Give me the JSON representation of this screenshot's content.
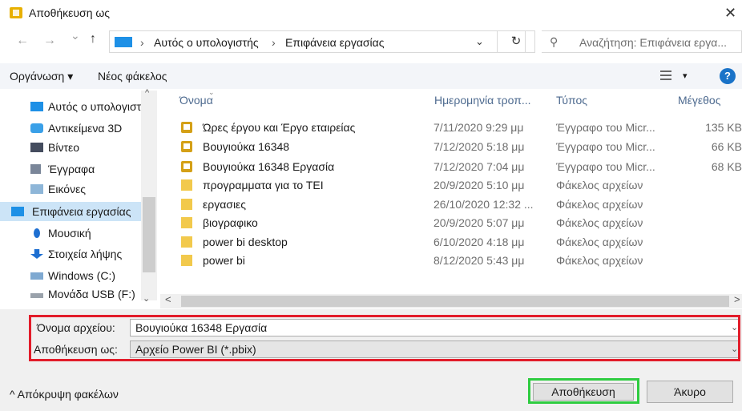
{
  "window": {
    "title": "Αποθήκευση ως",
    "close_glyph": "✕"
  },
  "nav": {
    "back_glyph": "←",
    "forward_glyph": "→",
    "recent_glyph": "⌄",
    "up_glyph": "↑",
    "breadcrumb": [
      "Αυτός ο υπολογιστής",
      "Επιφάνεια εργασίας"
    ],
    "separator": "›",
    "dropdown_glyph": "⌄",
    "refresh_glyph": "↻",
    "search_placeholder": "Αναζήτηση: Επιφάνεια εργα..."
  },
  "toolbar": {
    "organize_label": "Οργάνωση ▾",
    "new_folder_label": "Νέος φάκελος",
    "view_dropdown_glyph": "▾",
    "help_glyph": "?"
  },
  "sidebar": {
    "items": [
      {
        "label": "Αυτός ο υπολογιστής",
        "icon": "computer-icon",
        "color": "#1e90e6"
      },
      {
        "label": "Αντικείμενα 3D",
        "icon": "cube-3d-icon",
        "color": "#3aa0e8"
      },
      {
        "label": "Βίντεο",
        "icon": "film-icon",
        "color": "#444c5e"
      },
      {
        "label": "Έγγραφα",
        "icon": "document-icon",
        "color": "#7a8699"
      },
      {
        "label": "Εικόνες",
        "icon": "pictures-icon",
        "color": "#8eb6d8"
      },
      {
        "label": "Επιφάνεια εργασίας",
        "icon": "desktop-icon",
        "color": "#1e90e6",
        "selected": true
      },
      {
        "label": "Μουσική",
        "icon": "music-icon",
        "color": "#1e6fd1"
      },
      {
        "label": "Στοιχεία λήψης",
        "icon": "download-icon",
        "color": "#1e6fd1"
      },
      {
        "label": "Windows (C:)",
        "icon": "drive-icon",
        "color": "#7fa9d1"
      },
      {
        "label": "Μονάδα USB (F:)",
        "icon": "usb-drive-icon",
        "color": "#9aa2ab"
      }
    ]
  },
  "columns": {
    "name": "Όνομα",
    "date": "Ημερομηνία τροπ...",
    "type": "Τύπος",
    "size": "Μέγεθος"
  },
  "files": [
    {
      "name": "Ώρες έργου και Έργο εταιρείας",
      "date": "7/11/2020 9:29 μμ",
      "type": "Έγγραφο του Micr...",
      "size": "135 KB",
      "kind": "doc"
    },
    {
      "name": "Βουγιούκα 16348",
      "date": "7/12/2020 5:18 μμ",
      "type": "Έγγραφο του Micr...",
      "size": "66 KB",
      "kind": "doc"
    },
    {
      "name": "Βουγιούκα 16348 Εργασία",
      "date": "7/12/2020 7:04 μμ",
      "type": "Έγγραφο του Micr...",
      "size": "68 KB",
      "kind": "doc"
    },
    {
      "name": "προγραμματα για το ΤΕΙ",
      "date": "20/9/2020 5:10 μμ",
      "type": "Φάκελος αρχείων",
      "size": "",
      "kind": "folder"
    },
    {
      "name": "εργασιες",
      "date": "26/10/2020 12:32 ...",
      "type": "Φάκελος αρχείων",
      "size": "",
      "kind": "folder"
    },
    {
      "name": "βιογραφικο",
      "date": "20/9/2020 5:07 μμ",
      "type": "Φάκελος αρχείων",
      "size": "",
      "kind": "folder"
    },
    {
      "name": "power bi desktop",
      "date": "6/10/2020 4:18 μμ",
      "type": "Φάκελος αρχείων",
      "size": "",
      "kind": "folder"
    },
    {
      "name": "power bi",
      "date": "8/12/2020 5:43 μμ",
      "type": "Φάκελος αρχείων",
      "size": "",
      "kind": "folder"
    }
  ],
  "scroll": {
    "left_glyph": "<",
    "right_glyph": ">",
    "up_glyph": "^",
    "down_glyph": "⌄"
  },
  "save_form": {
    "filename_label": "Όνομα αρχείου:",
    "filename_value": "Βουγιούκα 16348 Εργασία",
    "type_label": "Αποθήκευση ως:",
    "type_value": "Αρχείο Power BI (*.pbix)",
    "dropdown_glyph": "⌄"
  },
  "footer": {
    "hide_folders_label": "^  Απόκρυψη φακέλων",
    "save_button": "Αποθήκευση",
    "cancel_button": "Άκυρο"
  },
  "colors": {
    "highlight_red": "#e21c2a",
    "highlight_green": "#2ecc40",
    "selection": "#cce4f7",
    "accent": "#1e90e6"
  }
}
